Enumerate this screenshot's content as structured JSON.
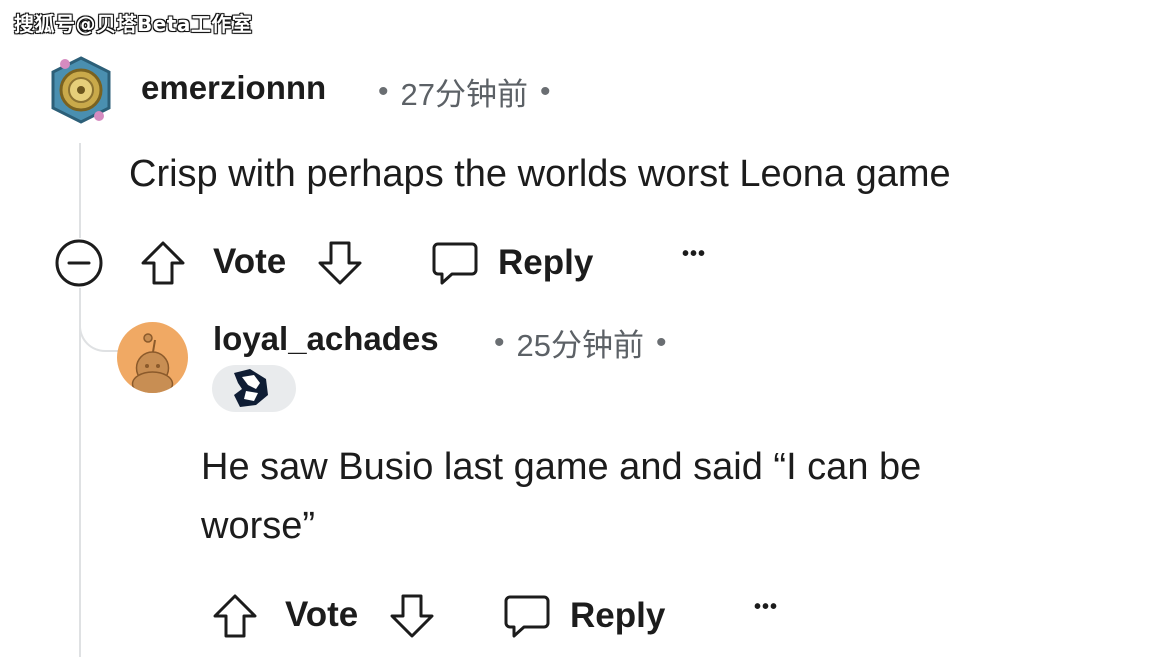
{
  "watermark": "搜狐号@贝塔Beta工作室",
  "comments": [
    {
      "author": "emerzionnn",
      "time": "27分钟前",
      "separator": "•",
      "body": "Crisp with perhaps the worlds worst Leona game",
      "actions": {
        "vote": "Vote",
        "reply": "Reply",
        "more": "•••"
      }
    },
    {
      "author": "loyal_achades",
      "time": "25分钟前",
      "separator": "•",
      "flair_icon": "team-liquid-horse-icon",
      "body_lines": [
        "He saw Busio last game and said “I can be",
        "worse”"
      ],
      "actions": {
        "vote": "Vote",
        "reply": "Reply",
        "more": "•••"
      }
    }
  ],
  "colors": {
    "text": "#1c1c1c",
    "meta": "#5c6166",
    "thread_line": "#dfe1e3",
    "avatar2_bg": "#f0a964",
    "flair_bg": "#e9ebed"
  }
}
